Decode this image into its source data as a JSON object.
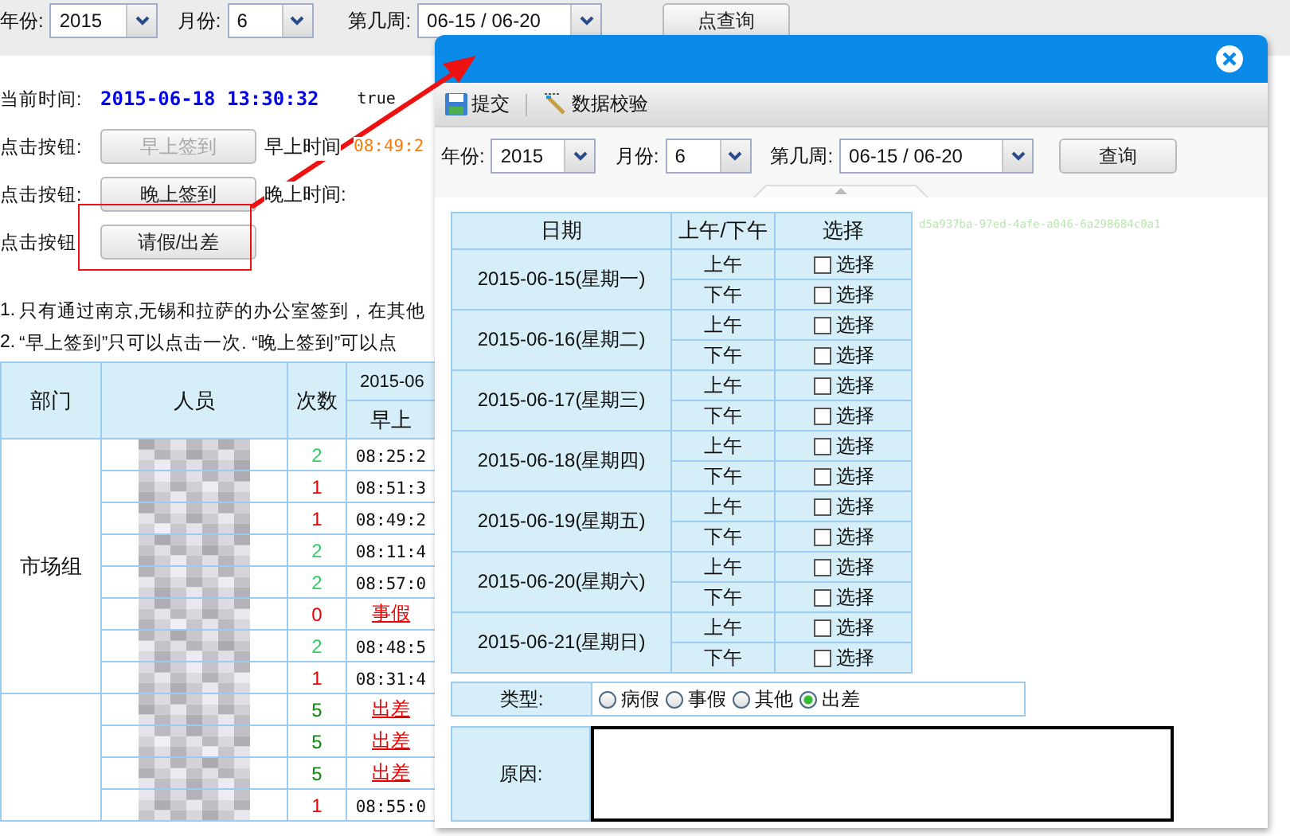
{
  "filters": {
    "year_label": "年份:",
    "year": "2015",
    "month_label": "月份:",
    "month": "6",
    "week_label": "第几周:",
    "week": "06-15 / 06-20",
    "query_button": "点查询"
  },
  "info": {
    "time_label": "当前时间:",
    "time": "2015-06-18 13:30:32",
    "flag": "true",
    "rows": [
      {
        "label": "点击按钮:",
        "button": "早上签到",
        "disabled": true,
        "time_label": "早上时间",
        "time": "08:49:2"
      },
      {
        "label": "点击按钮:",
        "button": "晚上签到",
        "disabled": false,
        "time_label": "晚上时间:"
      },
      {
        "label": "点击按钮",
        "button": "请假/出差",
        "disabled": false
      }
    ]
  },
  "notes": [
    "1.",
    "只有通过南京,无锡和拉萨的办公室签到，在其他",
    "2.",
    "“早上签到”只可以点击一次.  “晚上签到”可以点"
  ],
  "table": {
    "columns": [
      "部门",
      "人员",
      "次数",
      "2015-06"
    ],
    "subcolumn": "早上",
    "groups": [
      {
        "department": "市场组",
        "rows": [
          {
            "count": "2",
            "color": "#33cc66",
            "kind": "time",
            "morning": "08:25:2"
          },
          {
            "count": "1",
            "color": "#ee0000",
            "kind": "time",
            "morning": "08:51:3"
          },
          {
            "count": "1",
            "color": "#ee0000",
            "kind": "time",
            "morning": "08:49:2"
          },
          {
            "count": "2",
            "color": "#33cc66",
            "kind": "time",
            "morning": "08:11:4"
          },
          {
            "count": "2",
            "color": "#33cc66",
            "kind": "time",
            "morning": "08:57:0"
          },
          {
            "count": "0",
            "color": "#ee0000",
            "kind": "leave",
            "morning": "事假"
          },
          {
            "count": "2",
            "color": "#33cc66",
            "kind": "time",
            "morning": "08:48:5"
          },
          {
            "count": "1",
            "color": "#ee0000",
            "kind": "time",
            "morning": "08:31:4"
          }
        ]
      },
      {
        "rows": [
          {
            "count": "5",
            "color": "#118811",
            "kind": "leave",
            "morning": "出差"
          },
          {
            "count": "5",
            "color": "#118811",
            "kind": "leave",
            "morning": "出差"
          },
          {
            "count": "5",
            "color": "#118811",
            "kind": "leave",
            "morning": "出差"
          },
          {
            "count": "1",
            "color": "#ee0000",
            "kind": "time",
            "morning": "08:55:0"
          }
        ]
      }
    ]
  },
  "dialog": {
    "toolbar": [
      {
        "kind": "save",
        "label": "提交"
      },
      {
        "kind": "check",
        "label": "数据校验"
      }
    ],
    "filters": {
      "year_label": "年份:",
      "year": "2015",
      "month_label": "月份:",
      "month": "6",
      "week_label": "第几周:",
      "week": "06-15 / 06-20",
      "query_button": "查询"
    },
    "guid": "d5a937ba-97ed-4afe-a046-6a298684c0a1",
    "columns": [
      "日期",
      "上午/下午",
      "选择"
    ],
    "days": [
      {
        "date": "2015-06-15(星期一)",
        "halves": [
          {
            "label": "上午",
            "option": "选择",
            "checked": false
          },
          {
            "label": "下午",
            "option": "选择",
            "checked": false
          }
        ]
      },
      {
        "date": "2015-06-16(星期二)",
        "halves": [
          {
            "label": "上午",
            "option": "选择",
            "checked": false
          },
          {
            "label": "下午",
            "option": "选择",
            "checked": false
          }
        ]
      },
      {
        "date": "2015-06-17(星期三)",
        "halves": [
          {
            "label": "上午",
            "option": "选择",
            "checked": false
          },
          {
            "label": "下午",
            "option": "选择",
            "checked": false
          }
        ]
      },
      {
        "date": "2015-06-18(星期四)",
        "halves": [
          {
            "label": "上午",
            "option": "选择",
            "checked": false
          },
          {
            "label": "下午",
            "option": "选择",
            "checked": false
          }
        ]
      },
      {
        "date": "2015-06-19(星期五)",
        "halves": [
          {
            "label": "上午",
            "option": "选择",
            "checked": false
          },
          {
            "label": "下午",
            "option": "选择",
            "checked": false
          }
        ]
      },
      {
        "date": "2015-06-20(星期六)",
        "halves": [
          {
            "label": "上午",
            "option": "选择",
            "checked": false
          },
          {
            "label": "下午",
            "option": "选择",
            "checked": false
          }
        ]
      },
      {
        "date": "2015-06-21(星期日)",
        "halves": [
          {
            "label": "上午",
            "option": "选择",
            "checked": false
          },
          {
            "label": "下午",
            "option": "选择",
            "checked": false
          }
        ]
      }
    ],
    "type_label": "类型:",
    "types": [
      {
        "label": "病假",
        "selected": false
      },
      {
        "label": "事假",
        "selected": false
      },
      {
        "label": "其他",
        "selected": false
      },
      {
        "label": "出差",
        "selected": true
      }
    ],
    "reason_label": "原因:"
  }
}
